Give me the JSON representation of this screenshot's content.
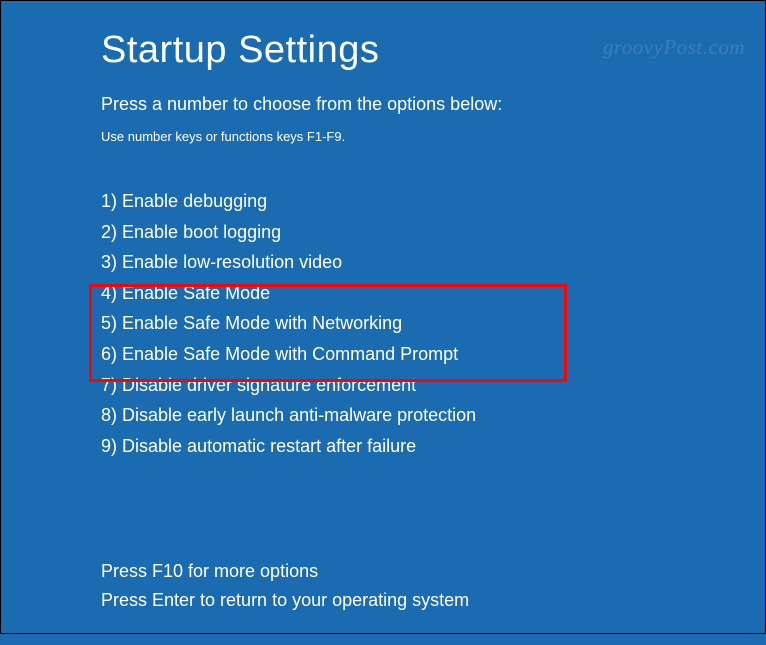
{
  "title": "Startup Settings",
  "subtitle": "Press a number to choose from the options below:",
  "hint": "Use number keys or functions keys F1-F9.",
  "options": [
    {
      "num": "1",
      "label": "Enable debugging"
    },
    {
      "num": "2",
      "label": "Enable boot logging"
    },
    {
      "num": "3",
      "label": "Enable low-resolution video"
    },
    {
      "num": "4",
      "label": "Enable Safe Mode"
    },
    {
      "num": "5",
      "label": "Enable Safe Mode with Networking"
    },
    {
      "num": "6",
      "label": "Enable Safe Mode with Command Prompt"
    },
    {
      "num": "7",
      "label": "Disable driver signature enforcement"
    },
    {
      "num": "8",
      "label": "Disable early launch anti-malware protection"
    },
    {
      "num": "9",
      "label": "Disable automatic restart after failure"
    }
  ],
  "footer": {
    "more": "Press F10 for more options",
    "return": "Press Enter to return to your operating system"
  },
  "watermark": "groovyPost.com"
}
